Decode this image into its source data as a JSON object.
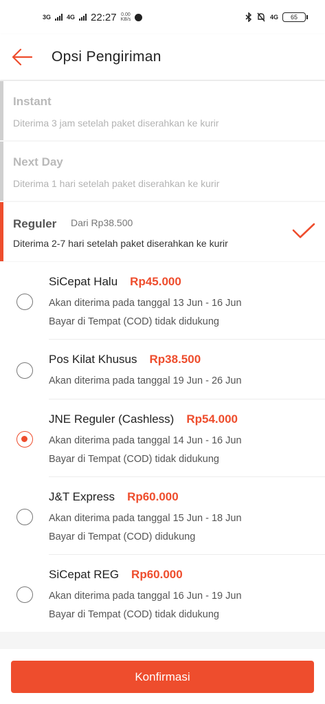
{
  "status_bar": {
    "net1": "3G",
    "net2": "4G",
    "time": "22:27",
    "speed_value": "0.00",
    "speed_unit": "KB/s",
    "network_type": "4G",
    "battery": "65"
  },
  "header": {
    "title": "Opsi Pengiriman",
    "back_icon": "arrow-left-icon"
  },
  "categories": [
    {
      "title": "Instant",
      "desc": "Diterima 3 jam setelah paket diserahkan ke kurir",
      "active": false
    },
    {
      "title": "Next Day",
      "desc": "Diterima 1 hari setelah paket diserahkan ke kurir",
      "active": false
    },
    {
      "title": "Reguler",
      "price": "Dari Rp38.500",
      "desc": "Diterima 2-7 hari setelah paket diserahkan ke kurir",
      "active": true
    }
  ],
  "options": [
    {
      "name": "SiCepat Halu",
      "price": "Rp45.000",
      "eta": "Akan diterima pada tanggal 13 Jun - 16 Jun",
      "cod": "Bayar di Tempat (COD) tidak didukung",
      "selected": false
    },
    {
      "name": "Pos Kilat Khusus",
      "price": "Rp38.500",
      "eta": "Akan diterima pada tanggal 19 Jun - 26 Jun",
      "selected": false
    },
    {
      "name": "JNE Reguler (Cashless)",
      "price": "Rp54.000",
      "eta": "Akan diterima pada tanggal 14 Jun - 16 Jun",
      "cod": "Bayar di Tempat (COD) tidak didukung",
      "selected": true
    },
    {
      "name": "J&T Express",
      "price": "Rp60.000",
      "eta": "Akan diterima pada tanggal 15 Jun - 18 Jun",
      "cod": "Bayar di Tempat (COD) didukung",
      "selected": false
    },
    {
      "name": "SiCepat REG",
      "price": "Rp60.000",
      "eta": "Akan diterima pada tanggal 16 Jun - 19 Jun",
      "cod": "Bayar di Tempat (COD) tidak didukung",
      "selected": false
    }
  ],
  "confirm_label": "Konfirmasi",
  "colors": {
    "accent": "#ee4d2d"
  }
}
